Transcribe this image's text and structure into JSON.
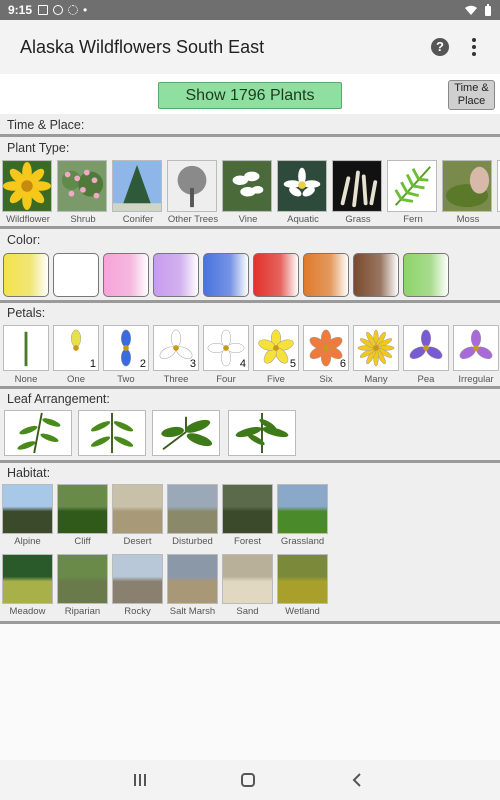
{
  "status": {
    "time": "9:15",
    "dot": "•"
  },
  "app": {
    "title": "Alaska Wildflowers South East",
    "help_glyph": "?"
  },
  "show_button": "Show 1796 Plants",
  "time_place_button": [
    "Time &",
    "Place"
  ],
  "sections": {
    "time_place": "Time & Place:",
    "plant_type": "Plant Type:",
    "color": "Color:",
    "petals": "Petals:",
    "leaf": "Leaf Arrangement:",
    "habitat": "Habitat:"
  },
  "plant_types": [
    "Wildflower",
    "Shrub",
    "Conifer",
    "Other Trees",
    "Vine",
    "Aquatic",
    "Grass",
    "Fern",
    "Moss"
  ],
  "colors": [
    "#f2e34b",
    "#ffffff",
    "#f7a3d9",
    "#c89bef",
    "#4a73e0",
    "#e2312a",
    "#e07a2a",
    "#7a4a2e",
    "#8ed46a"
  ],
  "petals": [
    {
      "label": "None",
      "num": ""
    },
    {
      "label": "One",
      "num": "1"
    },
    {
      "label": "Two",
      "num": "2"
    },
    {
      "label": "Three",
      "num": "3"
    },
    {
      "label": "Four",
      "num": "4"
    },
    {
      "label": "Five",
      "num": "5"
    },
    {
      "label": "Six",
      "num": "6"
    },
    {
      "label": "Many",
      "num": ""
    },
    {
      "label": "Pea",
      "num": ""
    },
    {
      "label": "Irregular",
      "num": ""
    }
  ],
  "habitats_row1": [
    "Alpine",
    "Cliff",
    "Desert",
    "Disturbed",
    "Forest",
    "Grassland"
  ],
  "habitats_row2": [
    "Meadow",
    "Riparian",
    "Rocky",
    "Salt Marsh",
    "Sand",
    "Wetland"
  ]
}
